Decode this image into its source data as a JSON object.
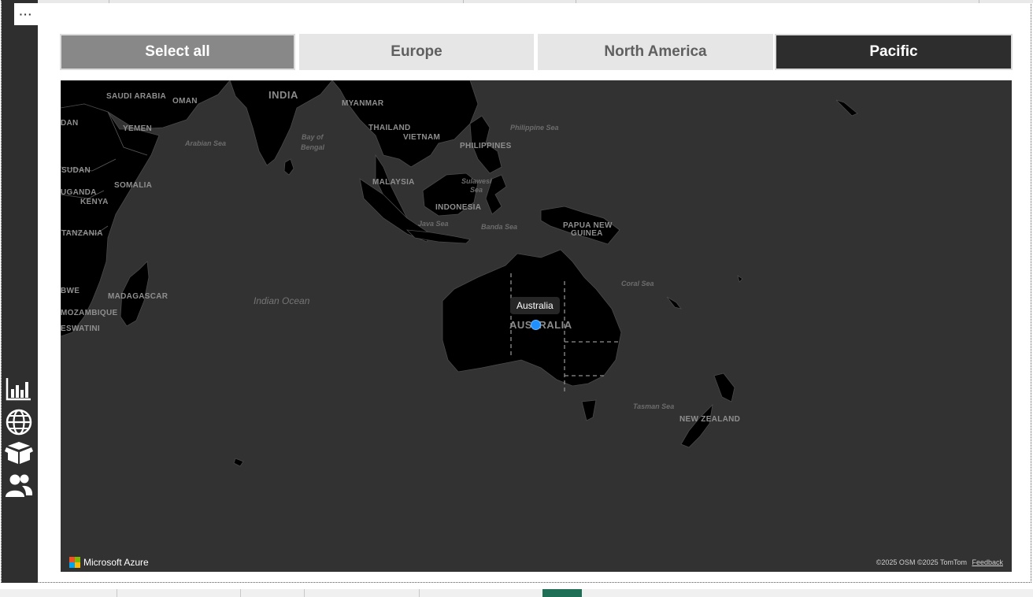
{
  "window": {
    "more_options_label": "···"
  },
  "sidebar": {
    "icons": [
      "bar-chart-icon",
      "globe-icon",
      "package-icon",
      "users-icon"
    ]
  },
  "slicer": {
    "buttons": [
      {
        "label": "Select all",
        "state": "partial"
      },
      {
        "label": "Europe",
        "state": "unselected"
      },
      {
        "label": "North America",
        "state": "unselected"
      },
      {
        "label": "Pacific",
        "state": "selected"
      }
    ]
  },
  "map": {
    "countries": [
      "SAUDI ARABIA",
      "OMAN",
      "INDIA",
      "MYANMAR",
      "YEMEN",
      "THAILAND",
      "VIETNAM",
      "PHILIPPINES",
      "SUDAN",
      "SOMALIA",
      "MALAYSIA",
      "UGANDA",
      "KENYA",
      "INDONESIA",
      "PAPUA NEW",
      "GUINEA",
      "TANZANIA",
      "MADAGASCAR",
      "MOZAMBIQUE",
      "ESWATINI",
      "NEW ZEALAND",
      "AUSTRALIA",
      "BWE",
      "DAN"
    ],
    "seas": [
      "Arabian Sea",
      "Bay of",
      "Bengal",
      "Philippine Sea",
      "Sulawesi",
      "Sea",
      "Java Sea",
      "Banda Sea",
      "Coral Sea",
      "Tasman Sea"
    ],
    "oceans": [
      "Indian Ocean"
    ],
    "tooltip": "Australia",
    "bubble_color": "#1e90ff",
    "brand": "Microsoft Azure",
    "copyright_osm": "©2025 OSM",
    "copyright_tomtom": "©2025 TomTom",
    "feedback": "Feedback"
  }
}
